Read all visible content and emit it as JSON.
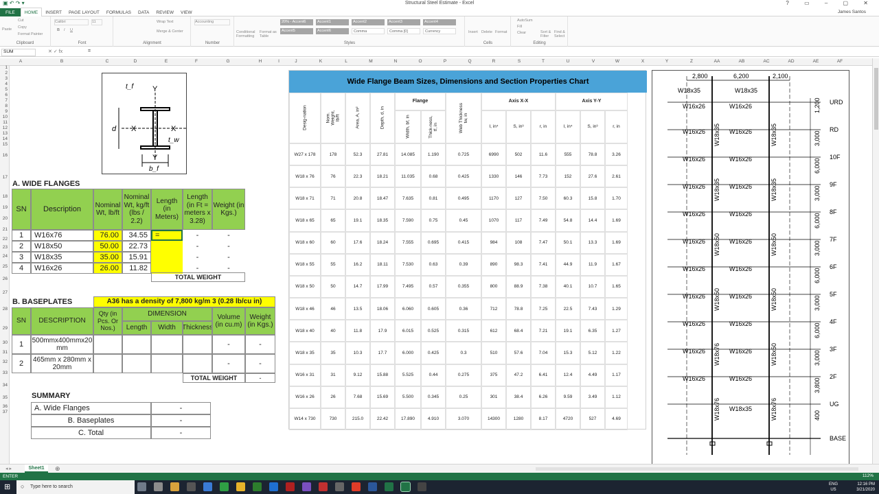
{
  "app": {
    "title": "Structural Steel Estimate - Excel",
    "user": "James Santos",
    "menu": [
      "FILE",
      "HOME",
      "INSERT",
      "PAGE LAYOUT",
      "FORMULAS",
      "DATA",
      "REVIEW",
      "VIEW"
    ],
    "ribbon_groups": [
      "Clipboard",
      "Font",
      "Alignment",
      "Number",
      "Styles",
      "Cells",
      "Editing"
    ],
    "ribbon_items": {
      "cut": "Cut",
      "copy": "Copy",
      "format_painter": "Format Painter",
      "paste": "Paste",
      "font_name": "Calibri",
      "font_size": "11",
      "wrap": "Wrap Text",
      "merge": "Merge & Center",
      "number_fmt": "Accounting",
      "cond_fmt": "Conditional Formatting",
      "fmt_table": "Format as Table",
      "insert": "Insert",
      "delete": "Delete",
      "format": "Format",
      "autosum": "AutoSum",
      "fill": "Fill",
      "clear": "Clear",
      "sort": "Sort & Filter",
      "find": "Find & Select"
    },
    "styles": [
      "20% - Accent6",
      "Accent1",
      "Accent2",
      "Accent3",
      "Accent4",
      "Accent5",
      "Accent6",
      "Comma",
      "Comma [0]",
      "Currency"
    ],
    "name_box": "SUM",
    "fx": "fx",
    "formula": "=",
    "sheet_tab": "Sheet1",
    "status": "ENTER",
    "zoom": "112%",
    "search_placeholder": "Type here to search",
    "clock_time": "12:16 PM",
    "clock_date": "3/21/2020",
    "lang": "ENG",
    "region": "US"
  },
  "columns": [
    "A",
    "B",
    "C",
    "D",
    "E",
    "F",
    "G",
    "H",
    "I",
    "J",
    "K",
    "L",
    "M",
    "N",
    "O",
    "P",
    "Q",
    "R",
    "S",
    "T",
    "U",
    "V",
    "W",
    "X",
    "Y",
    "Z",
    "AA",
    "AB",
    "AC",
    "AD",
    "AE",
    "AF"
  ],
  "rows": [
    "1",
    "2",
    "3",
    "4",
    "5",
    "6",
    "7",
    "8",
    "9",
    "10",
    "11",
    "12",
    "13",
    "14",
    "15",
    "16",
    "17",
    "18",
    "19",
    "20",
    "21",
    "22",
    "23",
    "24",
    "25",
    "26",
    "27",
    "28",
    "29",
    "30",
    "31",
    "32",
    "33",
    "34",
    "35",
    "36",
    "37"
  ],
  "wide_flanges": {
    "title": "A. WIDE FLANGES",
    "headers": [
      "SN",
      "Description",
      "Nominal Wt, lb/ft",
      "Nominal Wt, kg/ft (lbs / 2.2)",
      "Length (in Meters)",
      "Length (in Ft = meters x 3.28)",
      "Weight (in Kgs.)"
    ],
    "rows": [
      {
        "sn": "1",
        "desc": "W16x76",
        "lb": "76.00",
        "kg": "34.55",
        "len": "=",
        "ft": "-",
        "wt": "-"
      },
      {
        "sn": "2",
        "desc": "W18x50",
        "lb": "50.00",
        "kg": "22.73",
        "len": "",
        "ft": "-",
        "wt": "-"
      },
      {
        "sn": "3",
        "desc": "W18x35",
        "lb": "35.00",
        "kg": "15.91",
        "len": "",
        "ft": "-",
        "wt": "-"
      },
      {
        "sn": "4",
        "desc": "W16x26",
        "lb": "26.00",
        "kg": "11.82",
        "len": "",
        "ft": "-",
        "wt": "-"
      }
    ],
    "total_label": "TOTAL WEIGHT"
  },
  "baseplates": {
    "title": "B. BASEPLATES",
    "note": "A36 has a density of 7,800 kg/m 3 (0.28 lb/cu in)",
    "headers": {
      "sn": "SN",
      "desc": "DESCRIPTION",
      "qty": "Qty (in Pcs. Or Nos.)",
      "dim": "DIMENSION",
      "len": "Length",
      "wid": "Width",
      "thk": "Thickness",
      "vol": "Volume (in cu.m)",
      "wt": "Weight (in Kgs.)"
    },
    "rows": [
      {
        "sn": "1",
        "desc": "500mmx400mmx20 mm",
        "vol": "-",
        "wt": "-"
      },
      {
        "sn": "2",
        "desc": "465mm x 280mm x 20mm",
        "vol": "-",
        "wt": "-"
      }
    ],
    "total_label": "TOTAL WEIGHT",
    "total_value": "-"
  },
  "summary": {
    "title": "SUMMARY",
    "rows": [
      {
        "label": "A. Wide Flanges",
        "value": "-"
      },
      {
        "label": "B. Baseplates",
        "value": "-"
      },
      {
        "label": "C. Total",
        "value": "-"
      }
    ]
  },
  "beam_diagram": {
    "labels": [
      "Y",
      "X",
      "X",
      "Y",
      "d",
      "t_f",
      "t_w",
      "b_f"
    ]
  },
  "beam_chart": {
    "title": "Wide Flange Beam Sizes, Dimensions and Section Properties Chart",
    "group_headers": {
      "flange": "Flange",
      "axis_xx": "Axis X-X",
      "axis_yy": "Axis Y-Y"
    },
    "headers": [
      "Desig-nation",
      "Nom. Weight, lb/ft",
      "Area, A, in²",
      "Depth, d, in",
      "Width, bf, in",
      "Thick-ness, tf, in",
      "Web Thickness tw, in",
      "I, in⁴",
      "S, in³",
      "r, in",
      "I, in⁴",
      "S, in³",
      "r, in"
    ],
    "rows": [
      [
        "W27 x 178",
        "178",
        "52.3",
        "27.81",
        "14.085",
        "1.190",
        "0.725",
        "6990",
        "502",
        "11.6",
        "555",
        "78.8",
        "3.26"
      ],
      [
        "W18 x 76",
        "76",
        "22.3",
        "18.21",
        "11.035",
        "0.68",
        "0.425",
        "1330",
        "146",
        "7.73",
        "152",
        "27.6",
        "2.61"
      ],
      [
        "W18 x 71",
        "71",
        "20.8",
        "18.47",
        "7.635",
        "0.81",
        "0.495",
        "1170",
        "127",
        "7.50",
        "60.3",
        "15.8",
        "1.70"
      ],
      [
        "W18 x 65",
        "65",
        "19.1",
        "18.35",
        "7.590",
        "0.75",
        "0.45",
        "1070",
        "117",
        "7.49",
        "54.8",
        "14.4",
        "1.69"
      ],
      [
        "W18 x 60",
        "60",
        "17.6",
        "18.24",
        "7.555",
        "0.695",
        "0.415",
        "984",
        "108",
        "7.47",
        "50.1",
        "13.3",
        "1.69"
      ],
      [
        "W18 x 55",
        "55",
        "16.2",
        "18.11",
        "7.530",
        "0.63",
        "0.39",
        "890",
        "98.3",
        "7.41",
        "44.9",
        "11.9",
        "1.67"
      ],
      [
        "W18 x 50",
        "50",
        "14.7",
        "17.99",
        "7.495",
        "0.57",
        "0.355",
        "800",
        "88.9",
        "7.38",
        "40.1",
        "10.7",
        "1.65"
      ],
      [
        "W18 x 46",
        "46",
        "13.5",
        "18.06",
        "6.060",
        "0.605",
        "0.36",
        "712",
        "78.8",
        "7.25",
        "22.5",
        "7.43",
        "1.29"
      ],
      [
        "W18 x 40",
        "40",
        "11.8",
        "17.9",
        "6.015",
        "0.525",
        "0.315",
        "612",
        "68.4",
        "7.21",
        "19.1",
        "6.35",
        "1.27"
      ],
      [
        "W18 x 35",
        "35",
        "10.3",
        "17.7",
        "6.000",
        "0.425",
        "0.3",
        "510",
        "57.6",
        "7.04",
        "15.3",
        "5.12",
        "1.22"
      ],
      [
        "W16 x 31",
        "31",
        "9.12",
        "15.88",
        "5.525",
        "0.44",
        "0.275",
        "375",
        "47.2",
        "6.41",
        "12.4",
        "4.49",
        "1.17"
      ],
      [
        "W16 x 26",
        "26",
        "7.68",
        "15.69",
        "5.500",
        "0.345",
        "0.25",
        "301",
        "38.4",
        "6.26",
        "9.59",
        "3.49",
        "1.12"
      ],
      [
        "W14 x 730",
        "730",
        "215.0",
        "22.42",
        "17.890",
        "4.910",
        "3.070",
        "14300",
        "1280",
        "8.17",
        "4720",
        "527",
        "4.69"
      ]
    ]
  },
  "frame": {
    "spans": [
      "2,800",
      "6,200",
      "2,100"
    ],
    "levels": [
      "URD",
      "RD",
      "10F",
      "9F",
      "8F",
      "7F",
      "6F",
      "5F",
      "4F",
      "3F",
      "2F",
      "UG",
      "BASE"
    ],
    "heights": [
      "1,200",
      "3,000",
      "6,000",
      "3,000",
      "6,000",
      "3,000",
      "6,000",
      "3,000",
      "6,000",
      "3,000",
      "3,800",
      "400"
    ],
    "top_beams": [
      "W18x35",
      "W18x35"
    ],
    "beam_label": "W16x26",
    "col_left": [
      "W18x35",
      "W18x35",
      "W18x50",
      "W18x50",
      "W18x76",
      "W18x76"
    ],
    "col_right": [
      "W18x35",
      "W18x35",
      "W18x50",
      "W18x50",
      "W18x50",
      "W18x76"
    ],
    "ug_beam": "W18x35"
  }
}
